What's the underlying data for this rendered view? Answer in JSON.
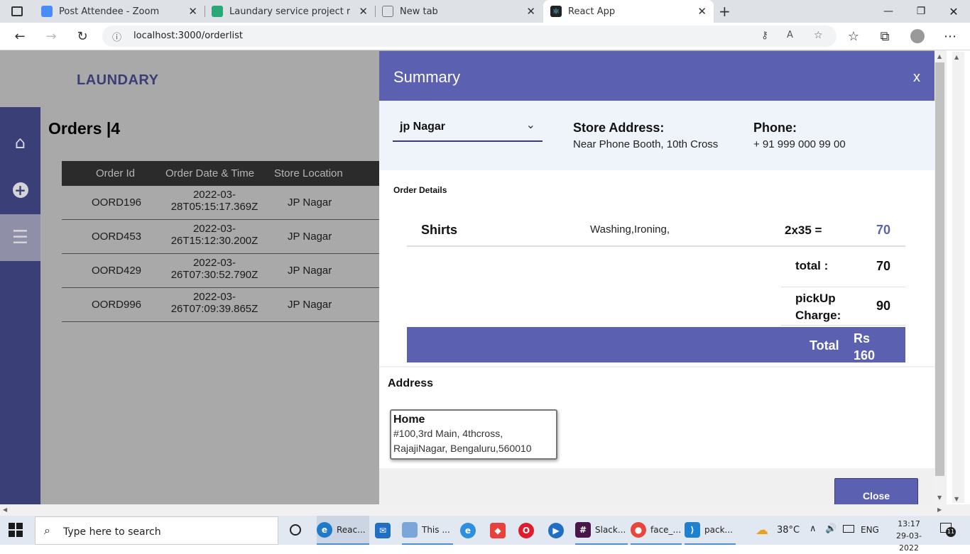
{
  "browser": {
    "tabs": [
      {
        "title": "Post Attendee - Zoom",
        "icon": "zoom-icon",
        "color": "#4a8cff"
      },
      {
        "title": "Laundary service project realted",
        "icon": "sheets-icon",
        "color": "#2aa876"
      },
      {
        "title": "New tab",
        "icon": "newtab-icon",
        "color": "#888888"
      },
      {
        "title": "React App",
        "icon": "react-icon",
        "color": "#222222"
      }
    ],
    "new_tab_symbol": "+",
    "url": "localhost:3000/orderlist"
  },
  "app": {
    "brand": "LAUNDARY",
    "orders_title": "Orders |4",
    "table": {
      "headers": [
        "Order Id",
        "Order Date & Time",
        "Store Location"
      ],
      "rows": [
        {
          "id": "OORD196",
          "date1": "2022-03-",
          "date2": "28T05:15:17.369Z",
          "location": "JP Nagar"
        },
        {
          "id": "OORD453",
          "date1": "2022-03-",
          "date2": "26T15:12:30.200Z",
          "location": "JP Nagar"
        },
        {
          "id": "OORD429",
          "date1": "2022-03-",
          "date2": "26T07:30:52.790Z",
          "location": "JP Nagar"
        },
        {
          "id": "OORD996",
          "date1": "2022-03-",
          "date2": "26T07:09:39.865Z",
          "location": "JP Nagar"
        }
      ]
    }
  },
  "summary": {
    "title": "Summary",
    "close_x": "x",
    "store_select": "jp Nagar",
    "store_address_label": "Store Address:",
    "store_address": "Near Phone Booth, 10th Cross",
    "phone_label": "Phone:",
    "phone": "+ 91 999 000 99 00",
    "order_details_label": "Order Details",
    "item": {
      "name": "Shirts",
      "services": "Washing,Ironing,",
      "qty_rate": "2x35 =",
      "amount": "70"
    },
    "subtotal_label": "total :",
    "subtotal": "70",
    "pickup_label_1": "pickUp",
    "pickup_label_2": "Charge:",
    "pickup": "90",
    "total_label": "Total",
    "total_currency": "Rs",
    "total_value": "160",
    "address_label": "Address",
    "address_card": {
      "title": "Home",
      "line1": "#100,3rd Main, 4thcross,",
      "line2": "RajajiNagar, Bengaluru,560010"
    },
    "close_button": "Close"
  },
  "taskbar": {
    "search_placeholder": "Type here to search",
    "apps": [
      {
        "label": "Reac...",
        "icon": "edge-icon"
      },
      {
        "label": "",
        "icon": "mail-icon"
      },
      {
        "label": "This ...",
        "icon": "explorer-icon"
      },
      {
        "label": "",
        "icon": "ie-icon"
      },
      {
        "label": "",
        "icon": "anydesk-icon"
      },
      {
        "label": "",
        "icon": "opera-icon"
      },
      {
        "label": "",
        "icon": "media-icon"
      },
      {
        "label": "Slack...",
        "icon": "slack-icon"
      },
      {
        "label": "face_...",
        "icon": "chrome-icon"
      },
      {
        "label": "pack...",
        "icon": "vscode-icon"
      }
    ],
    "weather": "38°C",
    "language": "ENG",
    "time": "13:17",
    "date": "29-03-2022",
    "notification_count": "11"
  }
}
